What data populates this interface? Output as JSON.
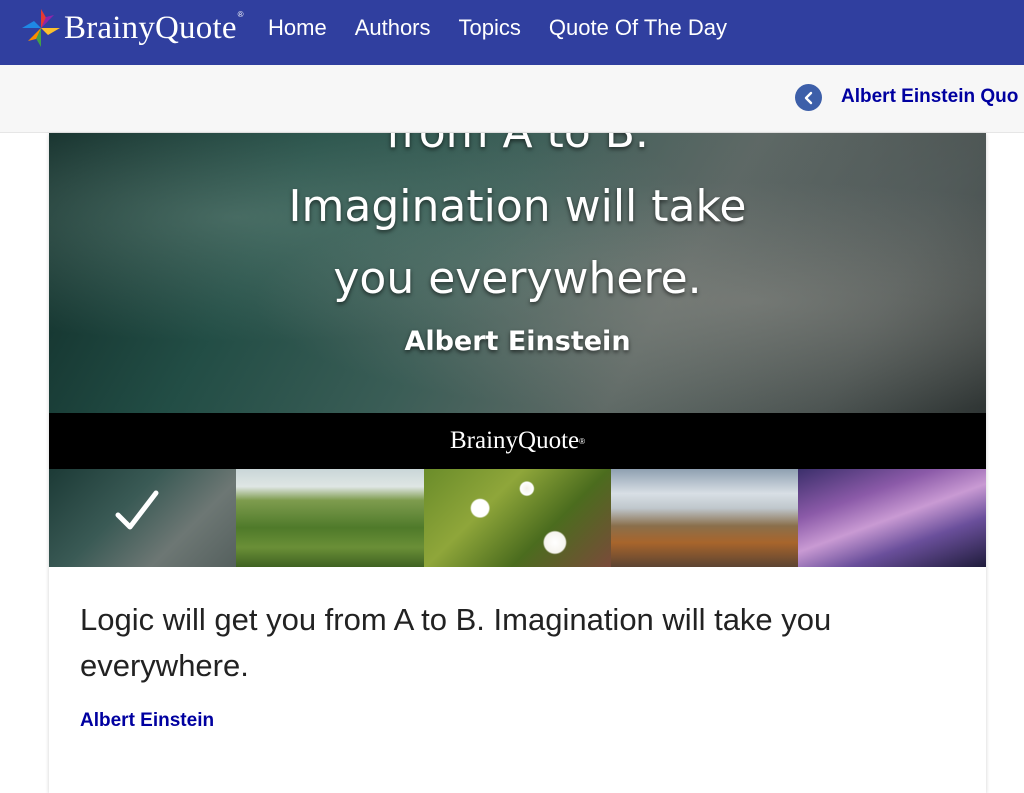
{
  "header": {
    "brand": "BrainyQuote",
    "brand_reg": "®",
    "nav": [
      "Home",
      "Authors",
      "Topics",
      "Quote Of The Day"
    ],
    "bg_color": "#303f9f"
  },
  "subbar": {
    "back_icon": "chevron-left-icon",
    "crumb": "Albert Einstein Quo"
  },
  "hero": {
    "line0": "from A to B.",
    "line1": "Imagination will take",
    "line2": "you everywhere.",
    "author": "Albert Einstein",
    "brand": "BrainyQuote",
    "brand_reg": "®"
  },
  "thumbnails": [
    {
      "name": "wave",
      "selected": true
    },
    {
      "name": "hills",
      "selected": false
    },
    {
      "name": "flowers",
      "selected": false
    },
    {
      "name": "mountains",
      "selected": false
    },
    {
      "name": "purple-sky",
      "selected": false
    }
  ],
  "quote": {
    "text": "Logic will get you from A to B. Imagination will take you everywhere.",
    "author": "Albert Einstein"
  },
  "colors": {
    "link": "#0000a0",
    "back_button": "#3d5fa9"
  }
}
